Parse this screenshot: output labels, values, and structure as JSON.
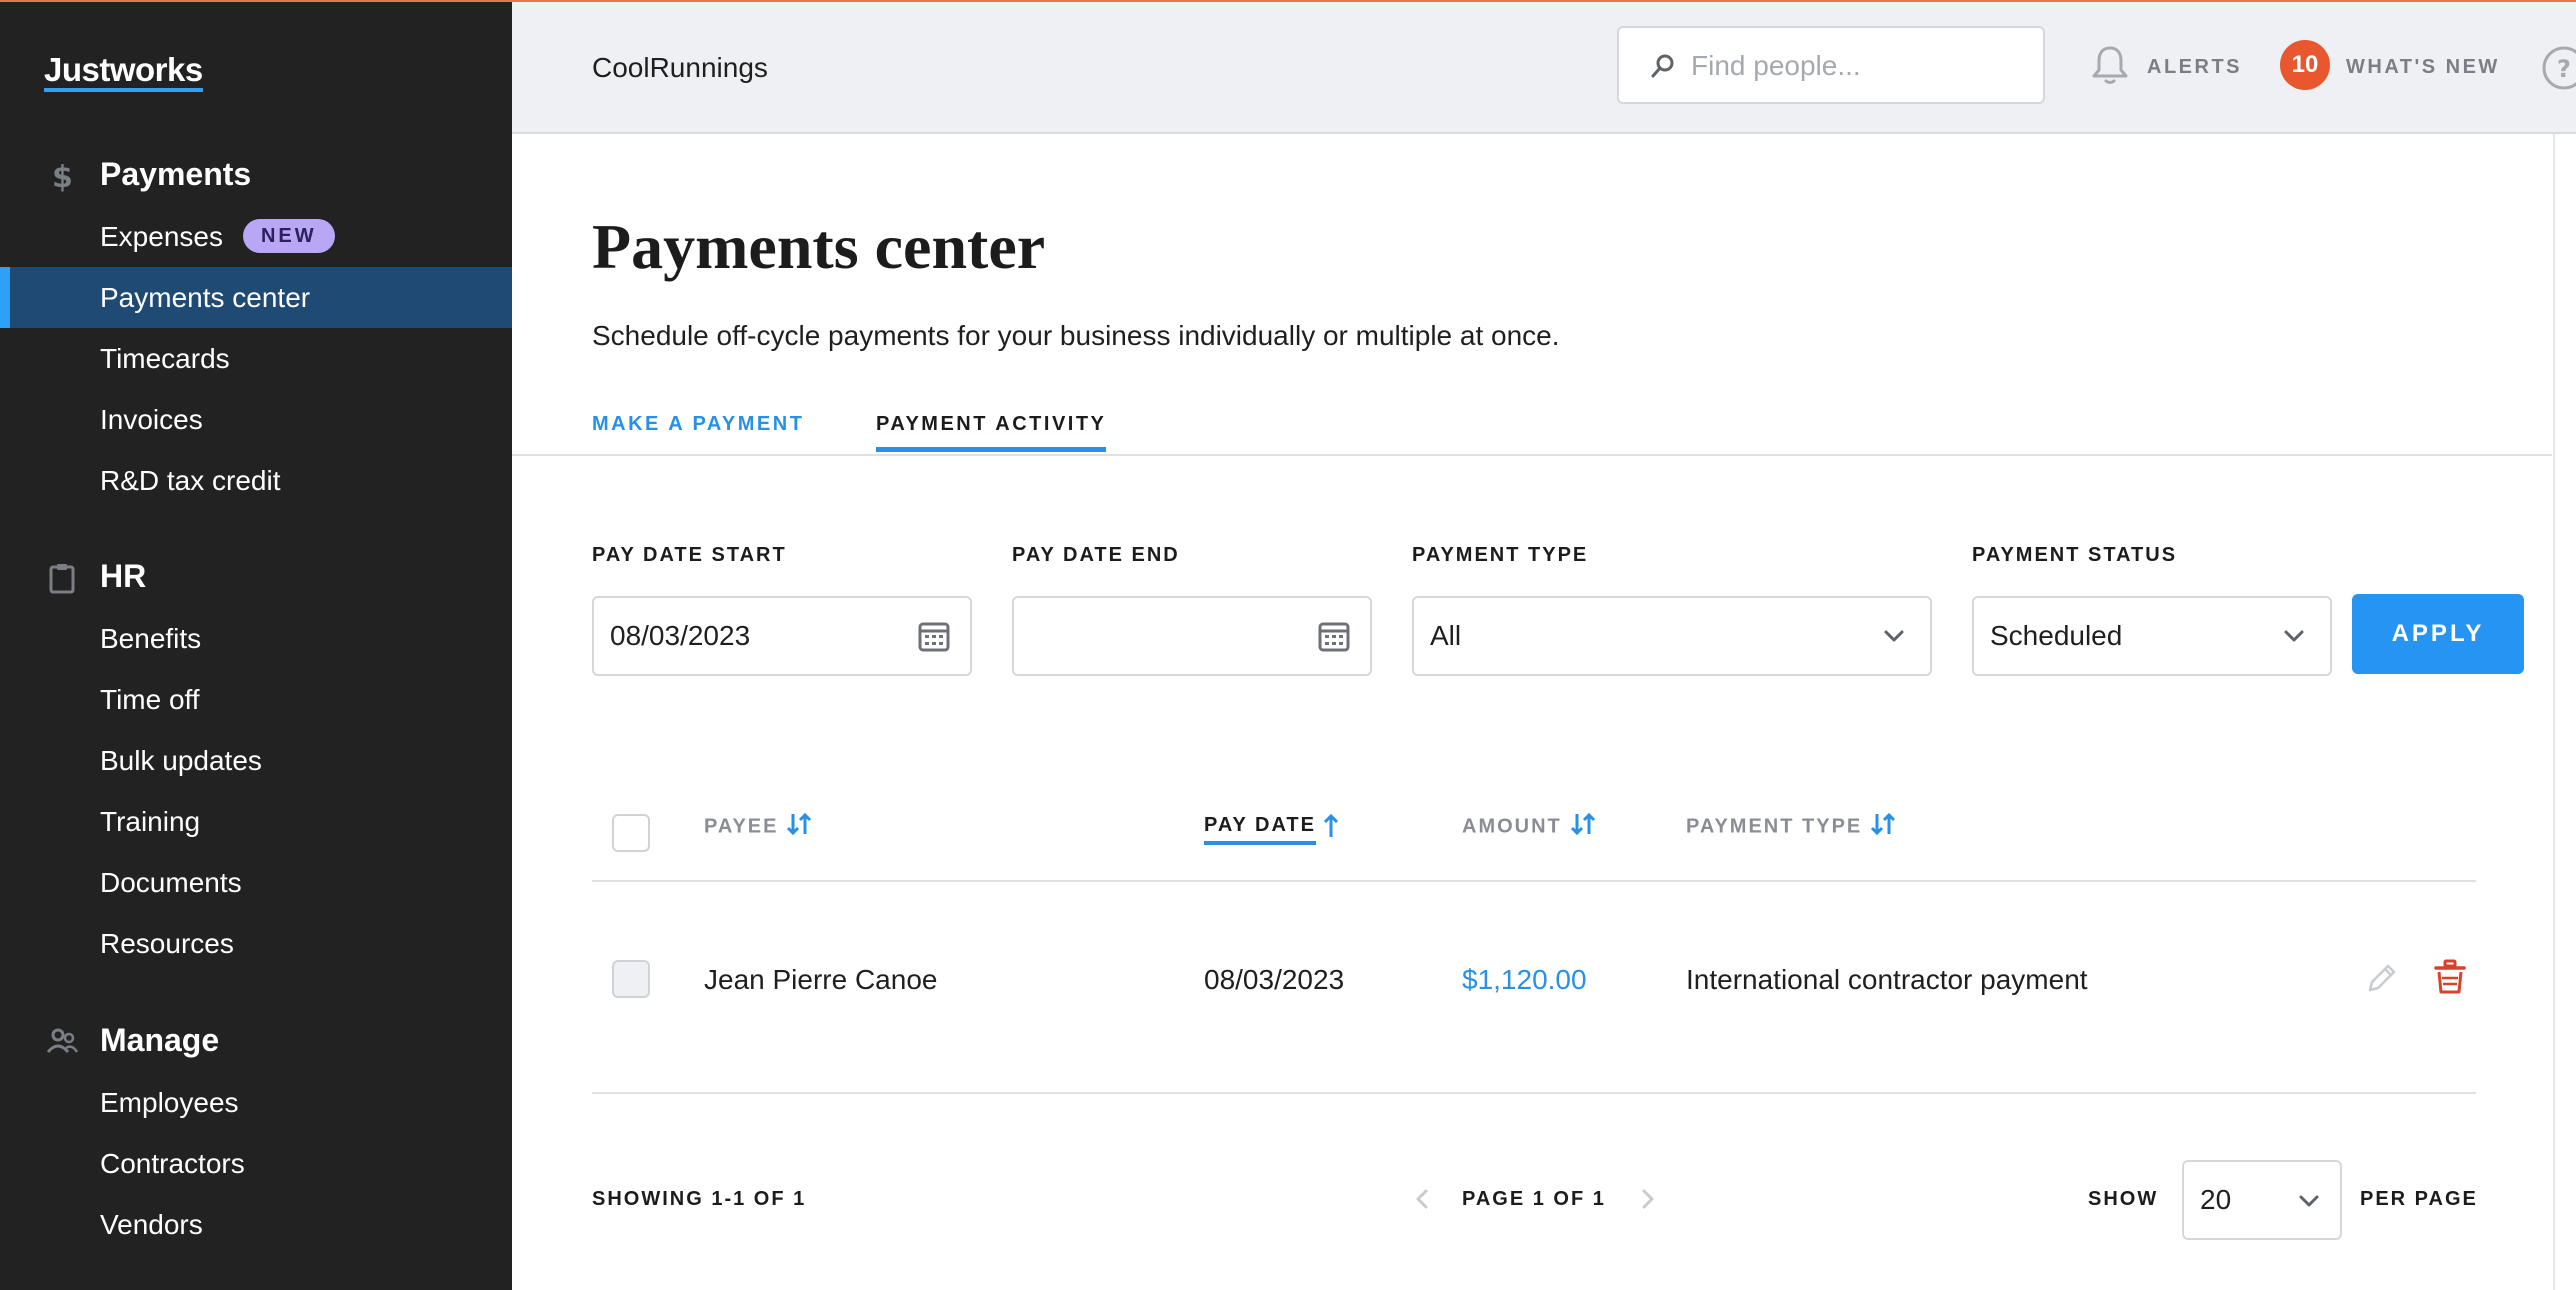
{
  "brand": {
    "logo": "Justworks"
  },
  "sidebar": {
    "sections": [
      {
        "title": "Payments",
        "icon": "dollar-icon",
        "items": [
          {
            "label": "Expenses",
            "badge": "NEW"
          },
          {
            "label": "Payments center",
            "active": true
          },
          {
            "label": "Timecards"
          },
          {
            "label": "Invoices"
          },
          {
            "label": "R&D tax credit"
          }
        ]
      },
      {
        "title": "HR",
        "icon": "clipboard-icon",
        "items": [
          {
            "label": "Benefits"
          },
          {
            "label": "Time off"
          },
          {
            "label": "Bulk updates"
          },
          {
            "label": "Training"
          },
          {
            "label": "Documents"
          },
          {
            "label": "Resources"
          }
        ]
      },
      {
        "title": "Manage",
        "icon": "people-icon",
        "items": [
          {
            "label": "Employees"
          },
          {
            "label": "Contractors"
          },
          {
            "label": "Vendors"
          }
        ]
      }
    ]
  },
  "header": {
    "company": "CoolRunnings",
    "search_placeholder": "Find people...",
    "alerts_label": "ALERTS",
    "whats_new_count": "10",
    "whats_new_label": "WHAT'S NEW"
  },
  "page": {
    "title": "Payments center",
    "subtitle": "Schedule off-cycle payments for your business individually or multiple at once.",
    "tabs": [
      {
        "label": "MAKE A PAYMENT"
      },
      {
        "label": "PAYMENT ACTIVITY",
        "active": true
      }
    ]
  },
  "filters": {
    "pay_date_start_label": "PAY DATE START",
    "pay_date_start_value": "08/03/2023",
    "pay_date_end_label": "PAY DATE END",
    "pay_date_end_value": "",
    "payment_type_label": "PAYMENT TYPE",
    "payment_type_value": "All",
    "payment_status_label": "PAYMENT STATUS",
    "payment_status_value": "Scheduled",
    "apply_label": "APPLY"
  },
  "table": {
    "columns": [
      "PAYEE",
      "PAY DATE",
      "AMOUNT",
      "PAYMENT TYPE"
    ],
    "rows": [
      {
        "payee": "Jean Pierre Canoe",
        "pay_date": "08/03/2023",
        "amount": "$1,120.00",
        "payment_type": "International contractor payment"
      }
    ]
  },
  "footer": {
    "showing": "SHOWING 1-1 OF 1",
    "page_label": "PAGE 1 OF 1",
    "show_label": "SHOW",
    "per_page_value": "20",
    "per_page_label": "PER PAGE"
  },
  "colors": {
    "accent": "#2594f2",
    "sidebar_bg": "#222222",
    "sidebar_active": "#1f4a73",
    "alert_badge": "#e8572e",
    "new_badge": "#b9a6f5",
    "delete": "#d9412b"
  }
}
